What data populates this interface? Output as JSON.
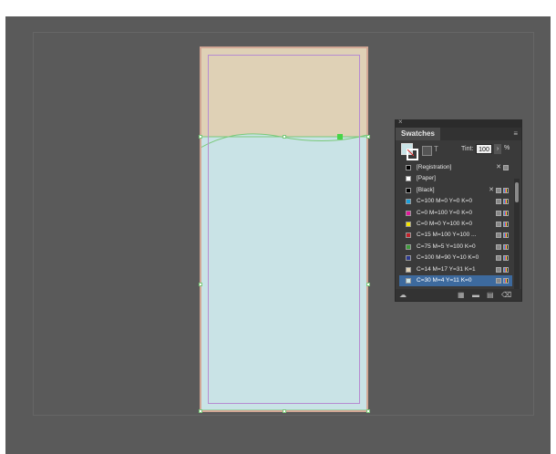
{
  "caption": "",
  "swatches_panel": {
    "close_label": "×",
    "tab_label": "Swatches",
    "menu_icon": "menu-icon",
    "tint_label": "Tint:",
    "tint_value": "100",
    "tint_arrow": "›",
    "tint_unit": "%",
    "colors": {
      "fill": "#c9e3e6",
      "selected_row": "#3d6a9e"
    },
    "swatches": [
      {
        "name": "[Registration]",
        "color": "#000000"
      },
      {
        "name": "[Paper]",
        "color": "#ffffff"
      },
      {
        "name": "[Black]",
        "color": "#000000"
      },
      {
        "name": "C=100 M=0 Y=0 K=0",
        "color": "#1ba0dc"
      },
      {
        "name": "C=0 M=100 Y=0 K=0",
        "color": "#e2189b"
      },
      {
        "name": "C=0 M=0 Y=100 K=0",
        "color": "#f5e400"
      },
      {
        "name": "C=15 M=100 Y=100 ...",
        "color": "#c0222a"
      },
      {
        "name": "C=75 M=5 Y=100 K=0",
        "color": "#3d9a3a"
      },
      {
        "name": "C=100 M=90 Y=10 K=0",
        "color": "#2b3990"
      },
      {
        "name": "C=14 M=17 Y=31 K=1",
        "color": "#dfd1b6"
      },
      {
        "name": "C=30 M=4 Y=11 K=0",
        "color": "#c9e3e6"
      }
    ]
  },
  "document": {
    "colors": {
      "top_fill": "#dfd1b6",
      "bottom_fill": "#c9e3e6",
      "selection": "#7ac97a",
      "margin": "#b68bd1"
    }
  }
}
